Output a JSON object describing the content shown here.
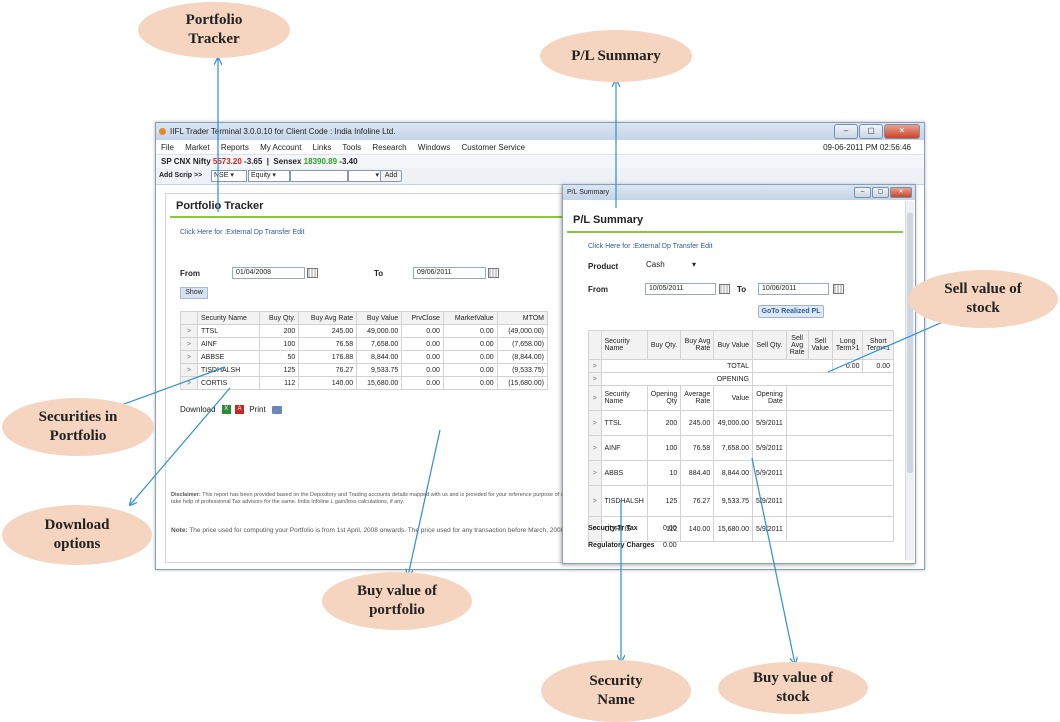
{
  "callouts": {
    "portfolio_tracker": "Portfolio Tracker",
    "pl_summary": "P/L Summary",
    "sell_value": "Sell value of stock",
    "securities": "Securities in Portfolio",
    "download": "Download options",
    "buy_value_portfolio": "Buy value of portfolio",
    "security_name": "Security Name",
    "buy_value_stock": "Buy value of stock"
  },
  "window": {
    "title": "IIFL Trader Terminal 3.0.0.10 for Client Code : India Infoline Ltd.",
    "controls": [
      "–",
      "▢",
      "✕"
    ],
    "menu": [
      "File",
      "Market",
      "Reports",
      "My Account",
      "Links",
      "Tools",
      "Research",
      "Windows",
      "Customer Service"
    ],
    "datetime": "09-06-2011 PM 02:56:46"
  },
  "ticker": {
    "idx1_name": "SP CNX Nifty",
    "idx1_value": "5573.20",
    "idx1_change": "-3.65",
    "idx2_name": "Sensex",
    "idx2_value": "18390.89",
    "idx2_change": "-3.40"
  },
  "scrip": {
    "label": "Add Scrip >>",
    "exchange": "NSE",
    "segment": "Equity",
    "symbol": "",
    "series": "",
    "add_label": "Add"
  },
  "portfolio": {
    "title": "Portfolio Tracker",
    "link": "Click Here for :External Dp Transfer Edit",
    "from_label": "From",
    "from_date": "01/04/2008",
    "to_label": "To",
    "to_date": "09/06/2011",
    "show_label": "Show",
    "columns": [
      "Security Name",
      "Buy Qty.",
      "Buy Avg Rate",
      "Buy Value",
      "PrvClose",
      "MarketValue",
      "MTOM"
    ],
    "rows": [
      [
        "TTSL",
        "200",
        "245.00",
        "49,000.00",
        "0.00",
        "0.00",
        "(49,000.00)"
      ],
      [
        "AINF",
        "100",
        "76.58",
        "7,658.00",
        "0.00",
        "0.00",
        "(7,658.00)"
      ],
      [
        "ABBSE",
        "50",
        "176.88",
        "8,844.00",
        "0.00",
        "0.00",
        "(8,844.00)"
      ],
      [
        "TISDHALSH",
        "125",
        "76.27",
        "9,533.75",
        "0.00",
        "0.00",
        "(9,533.75)"
      ],
      [
        "CORTIS",
        "112",
        "140.00",
        "15,680.00",
        "0.00",
        "0.00",
        "(15,680.00)"
      ]
    ],
    "download_label": "Download",
    "print_label": "Print",
    "disclaimer_head": "Disclaimer:",
    "disclaimer_text": "This report has been provided based on the Depository and Trading accounts details mapped with us and is provided for your reference purpose of calculation of your income tax liability and you are requested to take help of professional Tax advisors for the same. India Infoline L gain/loss calculations, if any.",
    "note_head": "Note:",
    "note_text": "The price used for computing your Portfolio is from 1st April, 2008 onwards. The price used for any transaction before March, 2008."
  },
  "pl": {
    "window_title": "P/L Summary",
    "title": "P/L Summary",
    "link": "Click Here for :External Dp Transfer Edit",
    "product_label": "Product",
    "product_value": "Cash",
    "from_label": "From",
    "from_date": "10/05/2011",
    "to_label": "To",
    "to_date": "10/06/2011",
    "goto_label": "GoTo Realized PL",
    "columns": [
      "Security Name",
      "Buy Qty.",
      "Buy Avg Rate",
      "Buy Value",
      "Sell Qty.",
      "Sell Avg Rate",
      "Sell Value",
      "Long Term>1",
      "Short Term<1"
    ],
    "total_label": "TOTAL",
    "total_long": "0.00",
    "total_short": "0.00",
    "opening_label": "OPENING",
    "open_columns": [
      "Security Name",
      "Opening Qty",
      "Average Rate",
      "Value",
      "Opening Date"
    ],
    "open_rows": [
      [
        "TTSL",
        "200",
        "245.00",
        "49,000.00",
        "5/9/2011"
      ],
      [
        "AINF",
        "100",
        "76.58",
        "7,658.00",
        "5/9/2011"
      ],
      [
        "ABBS",
        "10",
        "884.40",
        "8,844.00",
        "5/9/2011"
      ],
      [
        "TISDHALSH",
        "125",
        "76.27",
        "9,533.75",
        "5/9/2011"
      ],
      [
        "CORTIS",
        "112",
        "140.00",
        "15,680.00",
        "5/9/2011"
      ]
    ],
    "sec_tax_label": "Security Tr Tax",
    "sec_tax_value": "0.00",
    "reg_label": "Regulatory Charges",
    "reg_value": "0.00"
  }
}
